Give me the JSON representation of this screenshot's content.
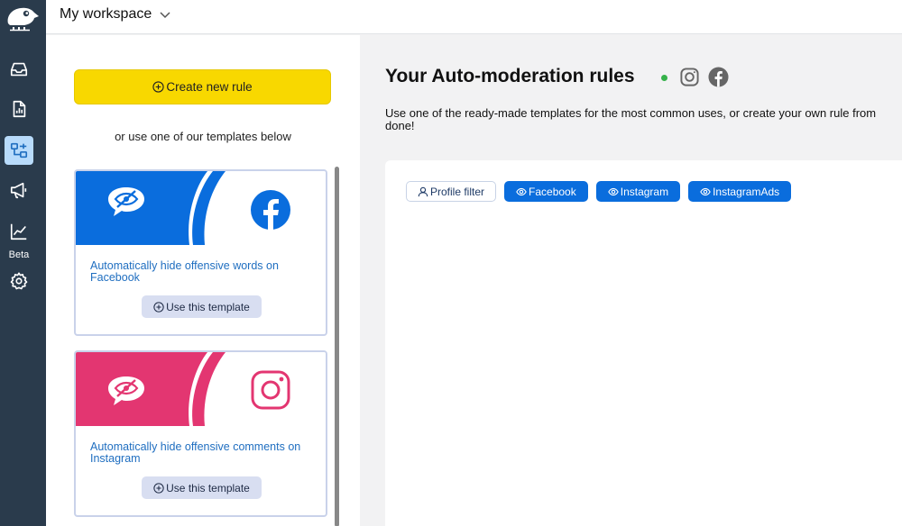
{
  "header": {
    "workspace_label": "My workspace"
  },
  "rail": {
    "beta_label": "Beta",
    "items": [
      {
        "icon": "inbox-icon"
      },
      {
        "icon": "report-icon"
      },
      {
        "icon": "rules-icon",
        "active": true
      },
      {
        "icon": "megaphone-icon"
      },
      {
        "icon": "chart-icon"
      },
      {
        "icon": "gear-icon"
      }
    ]
  },
  "templates_panel": {
    "create_label": "Create new rule",
    "or_text": "or use one of our templates below",
    "cards": [
      {
        "title": "Automatically hide offensive words on Facebook",
        "button_label": "Use this template",
        "network": "facebook",
        "color": "#0a6ddd"
      },
      {
        "title": "Automatically hide offensive comments on Instagram",
        "button_label": "Use this template",
        "network": "instagram",
        "color": "#e33671"
      }
    ]
  },
  "main": {
    "title": "Your Auto-moderation rules",
    "description_line1": "Use one of the ready-made templates for the most common uses, or create your own rule from",
    "description_line2": "done!",
    "status_color": "#36b24a",
    "filters": [
      {
        "label": "Profile filter",
        "icon": "user-icon",
        "style": "outline"
      },
      {
        "label": "Facebook",
        "icon": "eye-icon",
        "style": "solid"
      },
      {
        "label": "Instagram",
        "icon": "eye-icon",
        "style": "solid"
      },
      {
        "label": "InstagramAds",
        "icon": "eye-icon",
        "style": "solid"
      }
    ]
  }
}
